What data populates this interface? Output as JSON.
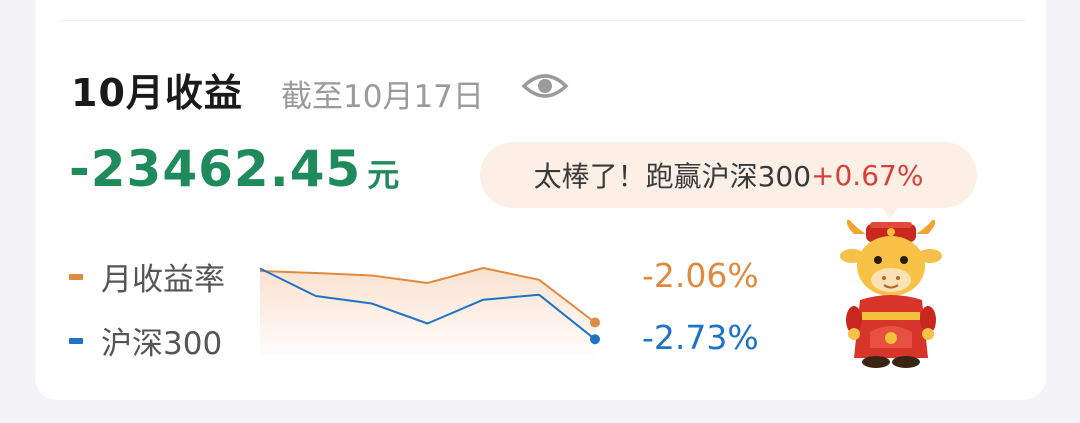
{
  "header": {
    "title": "10月收益",
    "as_of": "截至10月17日",
    "visibility_icon": "eye-icon"
  },
  "summary": {
    "amount": "-23462.45",
    "unit": "元",
    "amount_color": "#1f8a5c"
  },
  "bubble": {
    "text": "太棒了！跑赢沪深300",
    "gain": "+0.67%",
    "gain_color": "#d9403a"
  },
  "legend": [
    {
      "label": "月收益率",
      "value": "-2.06%",
      "color": "#e08a40"
    },
    {
      "label": "沪深300",
      "value": "-2.73%",
      "color": "#1f72c4"
    }
  ],
  "chart_data": {
    "type": "line",
    "ylim": [
      -3.0,
      0.2
    ],
    "series": [
      {
        "name": "月收益率",
        "values": [
          0.0,
          -0.08,
          -0.18,
          -0.48,
          0.12,
          -0.35,
          -2.06
        ]
      },
      {
        "name": "沪深300",
        "values": [
          0.1,
          -1.0,
          -1.3,
          -2.1,
          -1.15,
          -0.95,
          -2.73
        ]
      }
    ]
  },
  "mascot": {
    "icon": "ox-mascot-icon"
  }
}
